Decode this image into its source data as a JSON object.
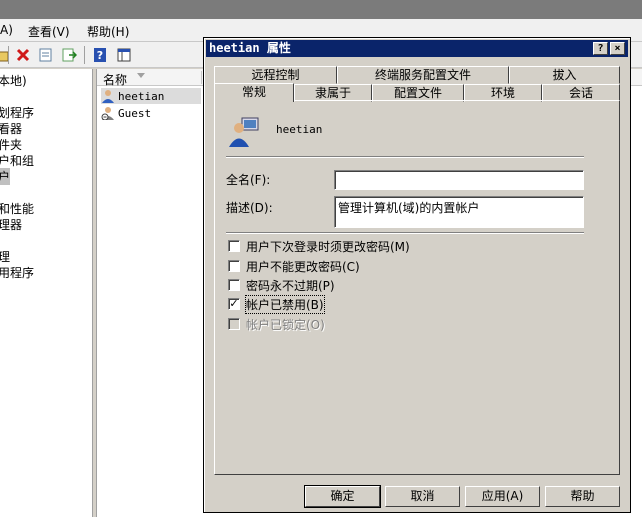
{
  "menu": {
    "action_fragment": "A)",
    "view": "查看(V)",
    "help": "帮助(H)"
  },
  "tree": {
    "items": [
      "本地)",
      "划程序",
      "看器",
      "件夹",
      "户和组",
      "户",
      "和性能",
      "理器",
      "理",
      "用程序"
    ]
  },
  "list": {
    "column_name": "名称",
    "users": [
      {
        "name": "heetian",
        "selected": true
      },
      {
        "name": "Guest",
        "selected": false
      }
    ]
  },
  "dialog": {
    "title_user": "heetian",
    "title_suffix": "属性",
    "help_glyph": "?",
    "close_glyph": "×",
    "tabs_top": [
      "远程控制",
      "终端服务配置文件",
      "拔入"
    ],
    "tabs_bottom": [
      "常规",
      "隶属于",
      "配置文件",
      "环境",
      "会话"
    ],
    "active_tab": "常规",
    "username": "heetian",
    "fullname_label": "全名(F):",
    "fullname_value": "",
    "description_label": "描述(D):",
    "description_value": "管理计算机(域)的内置帐户",
    "checkboxes": [
      {
        "label": "用户下次登录时须更改密码(M)",
        "checked": false,
        "enabled": true
      },
      {
        "label": "用户不能更改密码(C)",
        "checked": false,
        "enabled": true
      },
      {
        "label": "密码永不过期(P)",
        "checked": false,
        "enabled": true
      },
      {
        "label": "帐户已禁用(B)",
        "checked": true,
        "enabled": true
      },
      {
        "label": "帐户已锁定(O)",
        "checked": false,
        "enabled": false
      }
    ],
    "check_glyph": "✓",
    "buttons": {
      "ok": "确定",
      "cancel": "取消",
      "apply": "应用(A)",
      "help": "帮助"
    }
  },
  "colors": {
    "title_bar": "#0a246a",
    "dialog_face": "#d4d0c8",
    "window_bg": "#f0f0f0"
  }
}
